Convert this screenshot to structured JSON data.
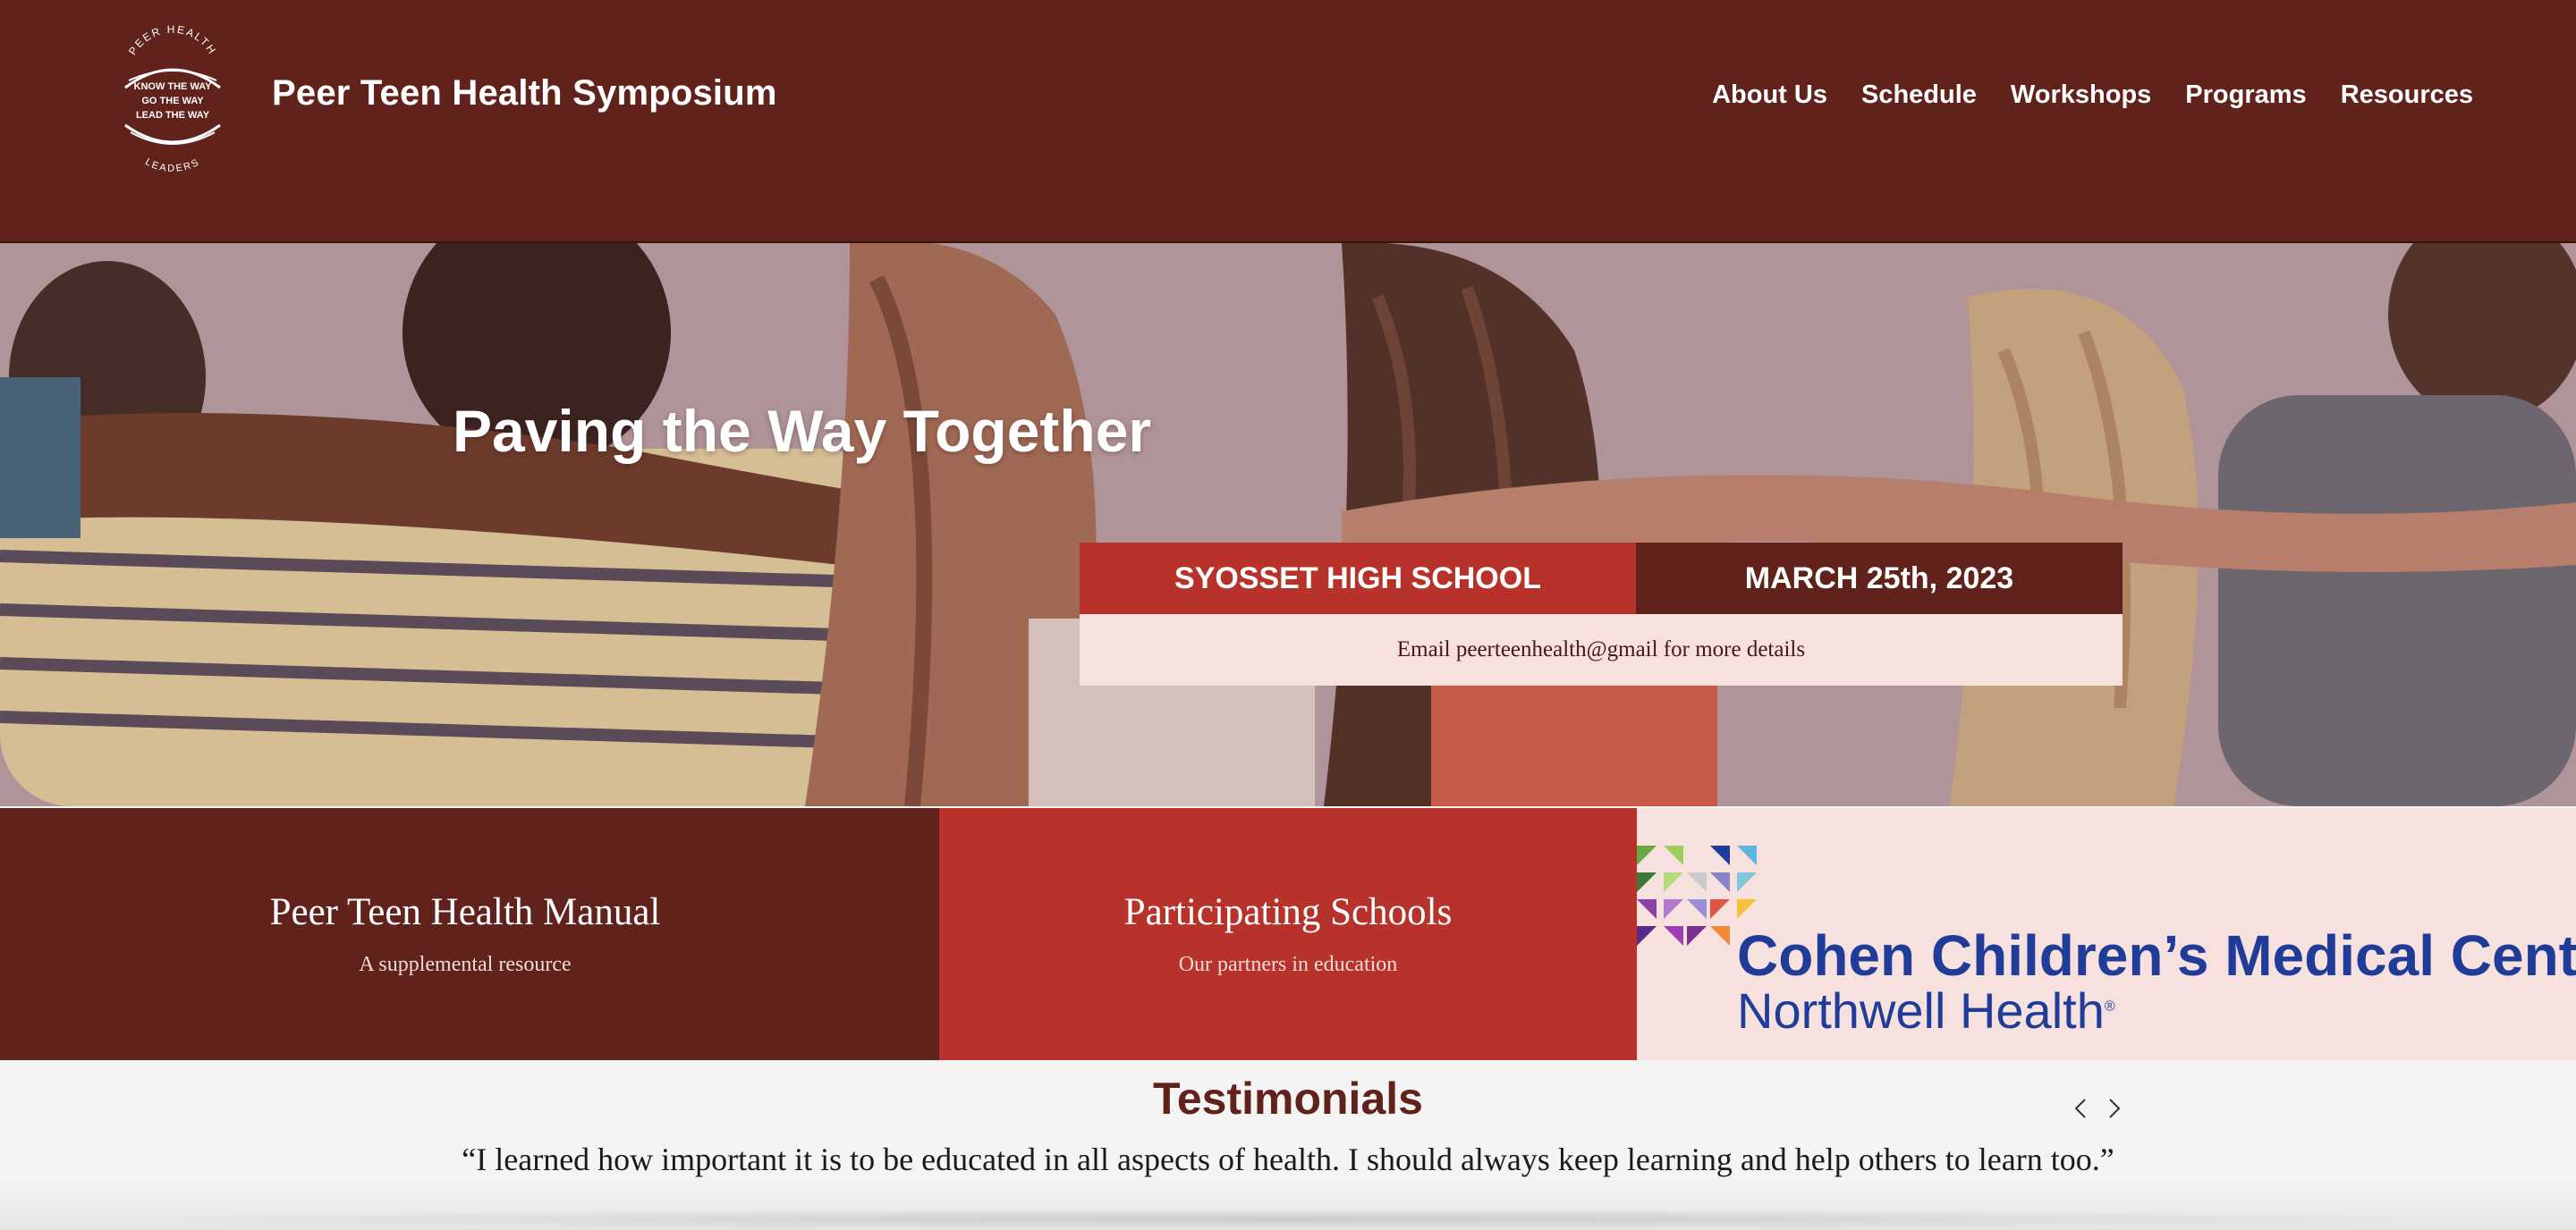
{
  "header": {
    "logo": {
      "arc_top": "PEER HEALTH",
      "lines": [
        "KNOW THE WAY",
        "GO THE WAY",
        "LEAD THE WAY"
      ],
      "arc_bottom": "LEADERS"
    },
    "site_title": "Peer Teen Health Symposium",
    "nav": [
      {
        "label": "About Us"
      },
      {
        "label": "Schedule"
      },
      {
        "label": "Workshops"
      },
      {
        "label": "Programs"
      },
      {
        "label": "Resources"
      }
    ]
  },
  "hero": {
    "title": "Paving the Way Together",
    "event": {
      "school": "SYOSSET HIGH SCHOOL",
      "date": "MARCH 25th, 2023",
      "email_note": "Email peerteenhealth@gmail for more details"
    }
  },
  "features": {
    "manual": {
      "title": "Peer Teen Health Manual",
      "subtitle": "A supplemental resource"
    },
    "schools": {
      "title": "Participating Schools",
      "subtitle": "Our partners in education"
    },
    "sponsor": {
      "name": "Cohen Children’s Medical Center",
      "sub": "Northwell Health",
      "reg": "®"
    }
  },
  "testimonials": {
    "title": "Testimonials",
    "quote": "“I learned how important it is to be educated in all aspects of health. I should always keep learning and help others to learn too.”",
    "prev_icon": "chevron-left-icon",
    "next_icon": "chevron-right-icon"
  },
  "colors": {
    "maroon": "#62221c",
    "red": "#b6322a",
    "blush": "#f7e1df",
    "sponsor_blue": "#1f3c99"
  }
}
